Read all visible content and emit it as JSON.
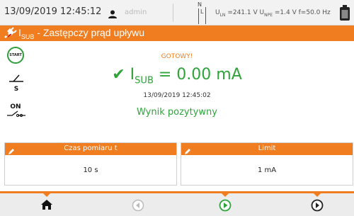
{
  "status": {
    "datetime": "13/09/2019 12:45:12",
    "user": "admin",
    "indicator_n": "N",
    "indicator_l": "L",
    "measurements": {
      "uln_label": "U",
      "uln_sub": "LN",
      "uln_value": "=241.1 V",
      "upe_label": "U",
      "upe_sub": "NPE",
      "upe_value": "=1.4 V",
      "freq": "f=50.0 Hz"
    },
    "icons": [
      "user-icon",
      "battery-icon"
    ]
  },
  "title": {
    "prefix": "I",
    "sub": "SUB",
    "text": " - Zastępczy prąd upływu",
    "icon": "plug-icon"
  },
  "left_controls": {
    "start_label": "START",
    "switch_label": "S",
    "on_label": "ON"
  },
  "result": {
    "state": "GOTOWY!",
    "symbol": "I",
    "symbol_sub": "SUB",
    "value_text": " = 0.00 mA",
    "timestamp": "13/09/2019 12:45:02",
    "verdict": "Wynik pozytywny"
  },
  "params": [
    {
      "label": "Czas pomiaru t",
      "value": "10 s"
    },
    {
      "label": "Limit",
      "value": "1 mA"
    }
  ],
  "colors": {
    "accent": "#f07d20",
    "success": "#2ea43a",
    "statusbar_bg": "#f2f2f2",
    "toolbar_bg": "#ececec"
  },
  "toolbar": {
    "buttons": [
      "home-icon",
      "previous-icon",
      "play-icon",
      "next-icon"
    ]
  }
}
